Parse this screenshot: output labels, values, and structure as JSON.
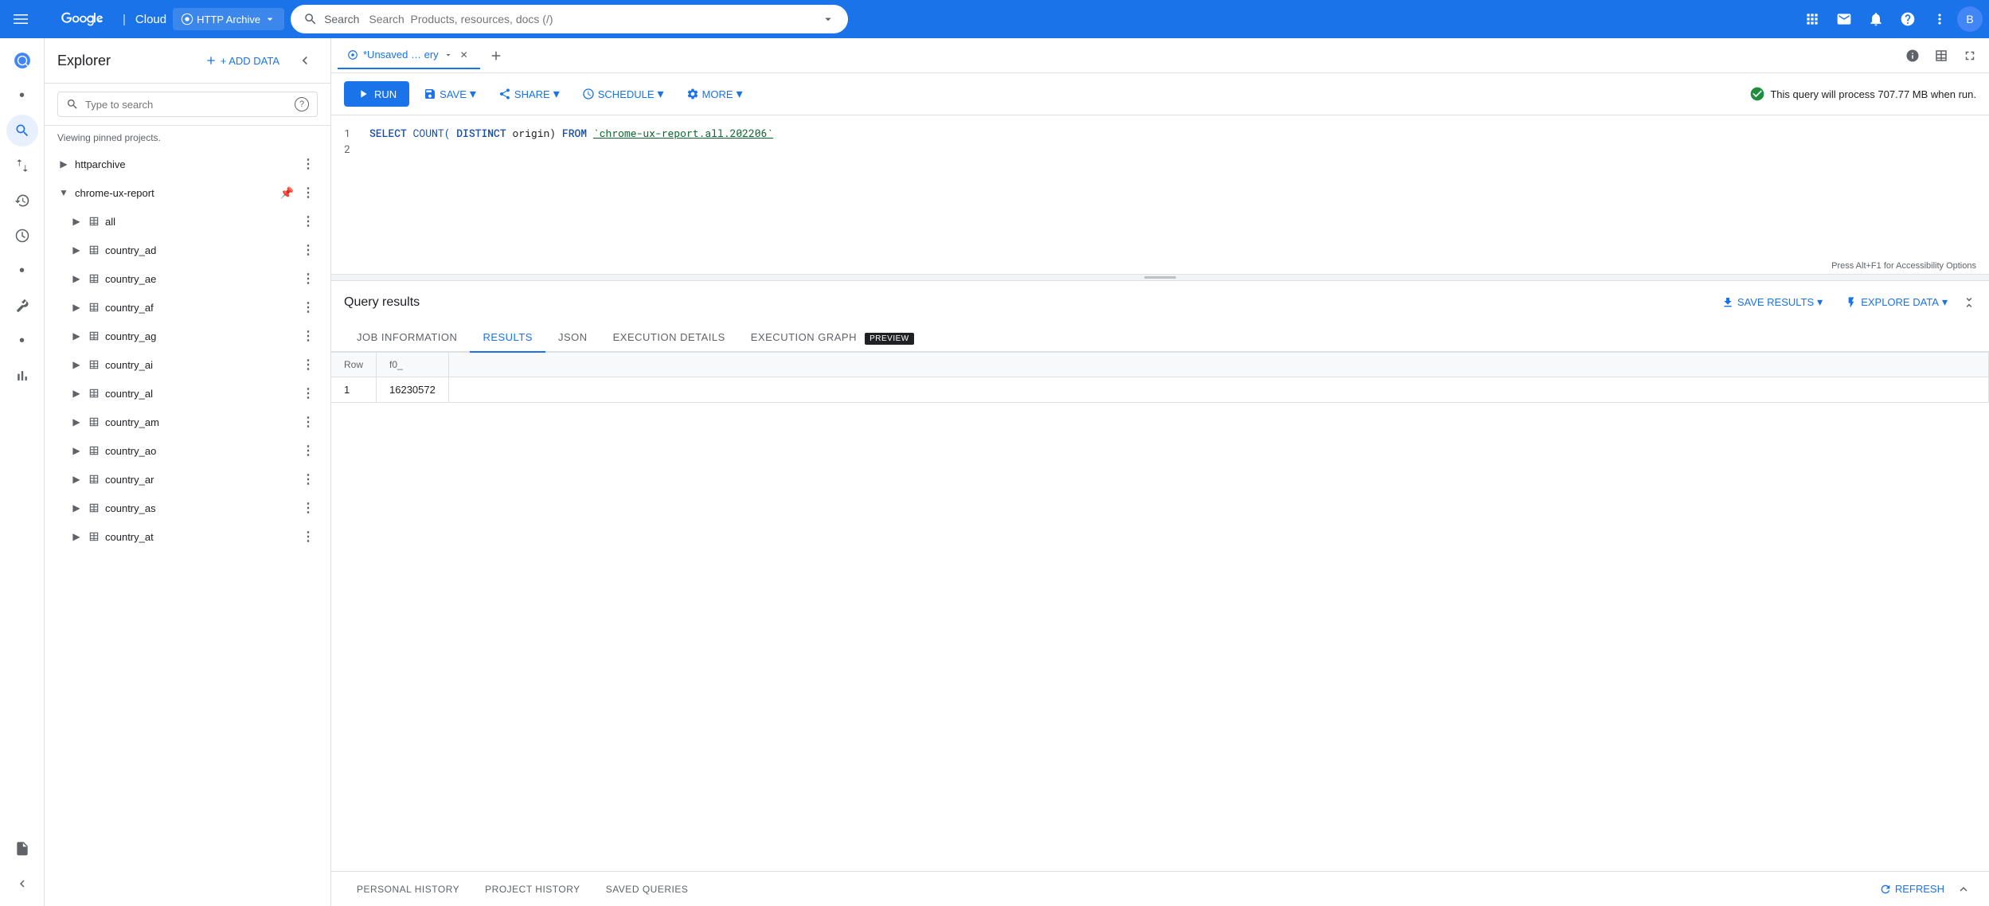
{
  "topNav": {
    "hamburger": "☰",
    "logoText": "Google Cloud",
    "projectName": "HTTP Archive",
    "searchPlaceholder": "Search  Products, resources, docs (/)",
    "avatarLabel": "B"
  },
  "sidebar": {
    "icons": [
      {
        "name": "query-icon",
        "symbol": "⊙",
        "active": false
      },
      {
        "name": "search-nav-icon",
        "symbol": "🔍",
        "active": true
      },
      {
        "name": "transfer-icon",
        "symbol": "⇄",
        "active": false
      },
      {
        "name": "history-icon",
        "symbol": "🕐",
        "active": false
      },
      {
        "name": "scheduled-icon",
        "symbol": "⊙",
        "active": false
      },
      {
        "name": "dot-nav-1",
        "symbol": "•",
        "active": false
      },
      {
        "name": "wrench-icon",
        "symbol": "🔧",
        "active": false
      },
      {
        "name": "dot-nav-2",
        "symbol": "•",
        "active": false
      },
      {
        "name": "chart-icon",
        "symbol": "📊",
        "active": false
      },
      {
        "name": "doc-icon",
        "symbol": "📄",
        "active": false
      }
    ]
  },
  "explorer": {
    "title": "Explorer",
    "addDataLabel": "+ ADD DATA",
    "collapseTitle": "Collapse",
    "searchPlaceholder": "Type to search",
    "viewingText": "Viewing pinned projects.",
    "treeItems": [
      {
        "id": "httparchive",
        "label": "httparchive",
        "indent": 0,
        "expanded": false,
        "hasPin": false,
        "hasTable": false
      },
      {
        "id": "chrome-ux-report",
        "label": "chrome-ux-report",
        "indent": 0,
        "expanded": true,
        "hasPin": true,
        "hasTable": false
      },
      {
        "id": "all",
        "label": "all",
        "indent": 1,
        "expanded": false,
        "hasPin": false,
        "hasTable": true
      },
      {
        "id": "country_ad",
        "label": "country_ad",
        "indent": 1,
        "expanded": false,
        "hasPin": false,
        "hasTable": true
      },
      {
        "id": "country_ae",
        "label": "country_ae",
        "indent": 1,
        "expanded": false,
        "hasPin": false,
        "hasTable": true
      },
      {
        "id": "country_af",
        "label": "country_af",
        "indent": 1,
        "expanded": false,
        "hasPin": false,
        "hasTable": true
      },
      {
        "id": "country_ag",
        "label": "country_ag",
        "indent": 1,
        "expanded": false,
        "hasPin": false,
        "hasTable": true
      },
      {
        "id": "country_ai",
        "label": "country_ai",
        "indent": 1,
        "expanded": false,
        "hasPin": false,
        "hasTable": true
      },
      {
        "id": "country_al",
        "label": "country_al",
        "indent": 1,
        "expanded": false,
        "hasPin": false,
        "hasTable": true
      },
      {
        "id": "country_am",
        "label": "country_am",
        "indent": 1,
        "expanded": false,
        "hasPin": false,
        "hasTable": true
      },
      {
        "id": "country_ao",
        "label": "country_ao",
        "indent": 1,
        "expanded": false,
        "hasPin": false,
        "hasTable": true
      },
      {
        "id": "country_ar",
        "label": "country_ar",
        "indent": 1,
        "expanded": false,
        "hasPin": false,
        "hasTable": true
      },
      {
        "id": "country_as",
        "label": "country_as",
        "indent": 1,
        "expanded": false,
        "hasPin": false,
        "hasTable": true
      },
      {
        "id": "country_at",
        "label": "country_at",
        "indent": 1,
        "expanded": false,
        "hasPin": false,
        "hasTable": true
      }
    ]
  },
  "tabBar": {
    "tabs": [
      {
        "id": "unsaved-query",
        "label": "*Unsaved … ery",
        "active": true,
        "closeable": true
      }
    ],
    "newTabLabel": "+",
    "infoIcon": "ℹ",
    "tableIcon": "⊞",
    "fullscreenIcon": "⤢"
  },
  "toolbar": {
    "runLabel": "RUN",
    "saveLabel": "SAVE",
    "shareLabel": "SHARE",
    "scheduleLabel": "SCHEDULE",
    "moreLabel": "MORE",
    "queryNotice": "This query will process 707.77 MB when run."
  },
  "codeEditor": {
    "lines": [
      {
        "num": 1,
        "code": "SELECT COUNT(DISTINCT origin) FROM `chrome-ux-report.all.202206`"
      },
      {
        "num": 2,
        "code": ""
      }
    ],
    "accessibilityHint": "Press Alt+F1 for Accessibility Options"
  },
  "results": {
    "title": "Query results",
    "saveResultsLabel": "SAVE RESULTS",
    "exploreDataLabel": "EXPLORE DATA",
    "tabs": [
      {
        "id": "job-information",
        "label": "JOB INFORMATION",
        "active": false
      },
      {
        "id": "results",
        "label": "RESULTS",
        "active": true
      },
      {
        "id": "json",
        "label": "JSON",
        "active": false
      },
      {
        "id": "execution-details",
        "label": "EXECUTION DETAILS",
        "active": false
      },
      {
        "id": "execution-graph",
        "label": "EXECUTION GRAPH",
        "active": false,
        "badge": "PREVIEW"
      }
    ],
    "tableHeaders": [
      "Row",
      "f0_"
    ],
    "tableRows": [
      {
        "row": "1",
        "value": "16230572"
      }
    ]
  },
  "bottomTabs": {
    "tabs": [
      {
        "id": "personal-history",
        "label": "PERSONAL HISTORY"
      },
      {
        "id": "project-history",
        "label": "PROJECT HISTORY"
      },
      {
        "id": "saved-queries",
        "label": "SAVED QUERIES"
      }
    ],
    "refreshLabel": "REFRESH",
    "collapseIcon": "∧"
  }
}
